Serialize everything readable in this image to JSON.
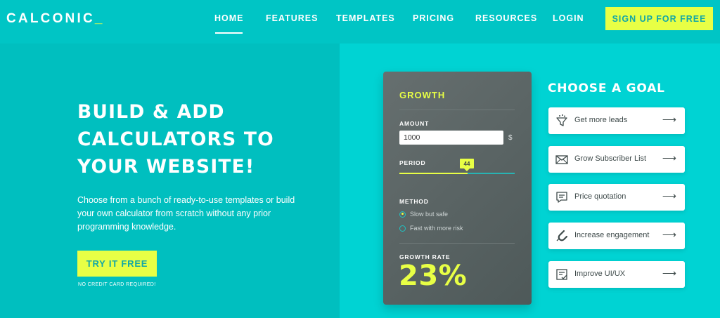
{
  "logo": {
    "text": "CALCONIC",
    "cursor": "_"
  },
  "nav": {
    "home": "HOME",
    "features": "FEATURES",
    "templates": "TEMPLATES",
    "pricing": "PRICING",
    "resources": "RESOURCES",
    "login": "LOGIN",
    "signup": "SIGN UP FOR FREE"
  },
  "hero": {
    "title_lines": [
      "BUILD & ADD",
      "CALCULATORS TO",
      "YOUR WEBSITE!"
    ],
    "description": "Choose from a bunch of ready-to-use templates or build your own calculator from scratch without any prior programming knowledge.",
    "cta": "TRY IT FREE",
    "cta_note": "NO CREDIT CARD REQUIRED!"
  },
  "calculator": {
    "title": "GROWTH",
    "amount_label": "AMOUNT",
    "amount_value": "1000",
    "currency": "$",
    "period_label": "PERIOD",
    "period_value": "44",
    "method_label": "METHOD",
    "method_options": [
      "Slow but safe",
      "Fast with more risk"
    ],
    "method_selected": "Slow but safe",
    "result_label": "GROWTH RATE",
    "result_value": "23%"
  },
  "goals": {
    "title": "CHOOSE A GOAL",
    "items": [
      {
        "label": "Get more leads",
        "icon": "funnel-icon"
      },
      {
        "label": "Grow Subscriber List",
        "icon": "envelope-icon"
      },
      {
        "label": "Price quotation",
        "icon": "quote-icon"
      },
      {
        "label": "Increase engagement",
        "icon": "magnet-icon"
      },
      {
        "label": "Improve UI/UX",
        "icon": "checklist-icon"
      }
    ],
    "arrow": "⟶"
  },
  "colors": {
    "accent": "#e8ff45",
    "header_bg": "#00c5c5",
    "left_bg": "#00bfbf",
    "right_bg": "#00d3d3",
    "card_bg": "#5a6464"
  }
}
